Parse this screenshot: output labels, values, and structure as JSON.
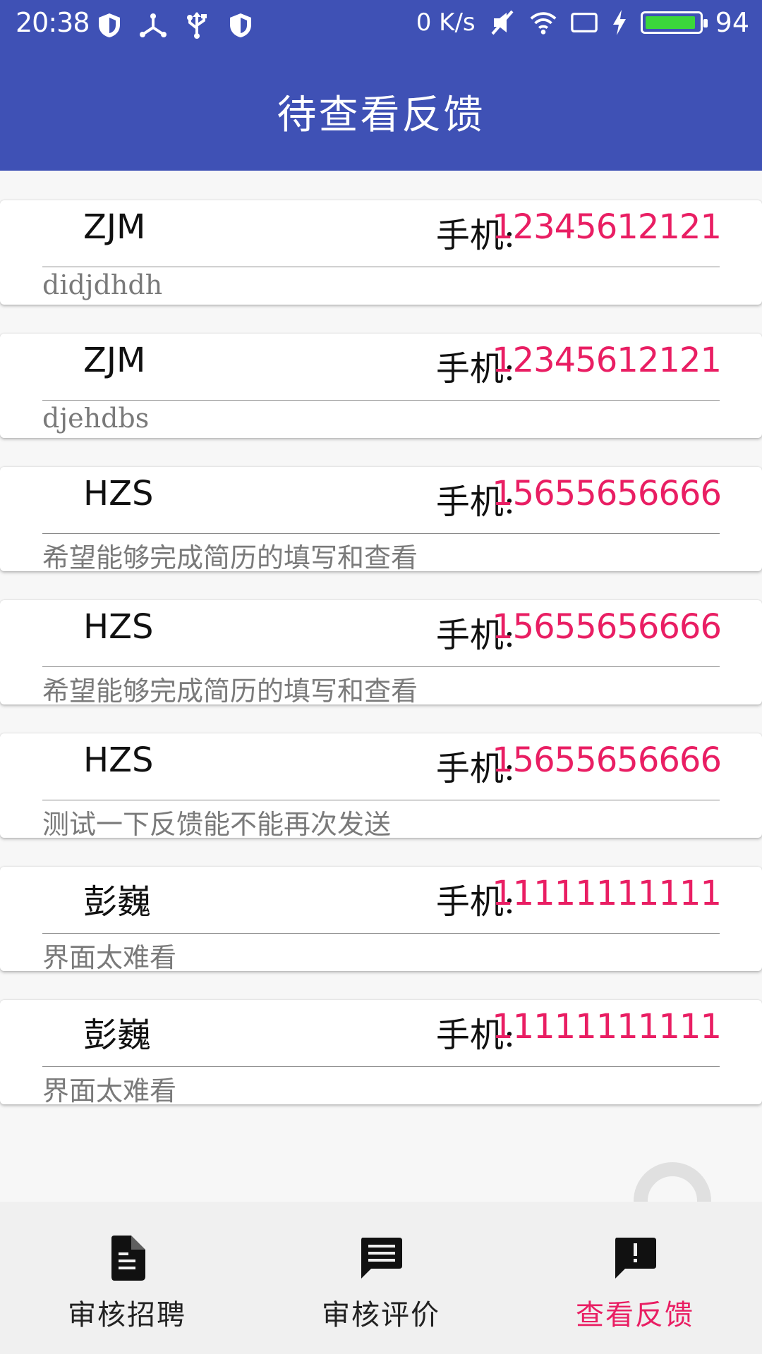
{
  "status_bar": {
    "time": "20:38",
    "speed": "0 K/s",
    "battery_level": "94",
    "battery_fraction": 0.94,
    "left_icons": [
      "shield-icon",
      "usb-share-icon",
      "usb-icon",
      "shield-icon"
    ],
    "right_icons": [
      "mute-icon",
      "wifi-icon",
      "screen-icon",
      "charging-icon",
      "battery-icon"
    ]
  },
  "app_bar": {
    "title": "待查看反馈"
  },
  "colors": {
    "primary": "#3f51b5",
    "accent": "#e91e63",
    "battery": "#3bd63b"
  },
  "phone_prefix": "手机:",
  "feedback_items": [
    {
      "name": "ZJM",
      "phone": "12345612121",
      "message": "didjdhdh"
    },
    {
      "name": "ZJM",
      "phone": "12345612121",
      "message": "djehdbs"
    },
    {
      "name": "HZS",
      "phone": "15655656666",
      "message": "希望能够完成简历的填写和查看"
    },
    {
      "name": "HZS",
      "phone": "15655656666",
      "message": "希望能够完成简历的填写和查看"
    },
    {
      "name": "HZS",
      "phone": "15655656666",
      "message": "测试一下反馈能不能再次发送"
    },
    {
      "name": "彭巍",
      "phone": "11111111111",
      "message": "界面太难看"
    },
    {
      "name": "彭巍",
      "phone": "11111111111",
      "message": "界面太难看"
    }
  ],
  "bottom_nav": [
    {
      "label": "审核招聘",
      "icon": "document-icon",
      "active": false
    },
    {
      "label": "审核评价",
      "icon": "message-icon",
      "active": false
    },
    {
      "label": "查看反馈",
      "icon": "feedback-icon",
      "active": true
    }
  ]
}
